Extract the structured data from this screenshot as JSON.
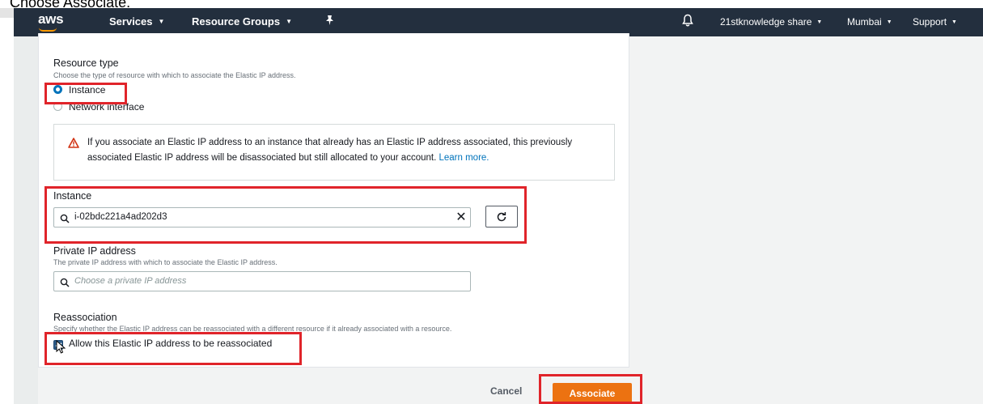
{
  "caption": "Choose Associate.",
  "navbar": {
    "logo": "aws",
    "services": "Services",
    "resource_groups": "Resource Groups",
    "account": "21stknowledge share",
    "region": "Mumbai",
    "support": "Support",
    "background_color": "#232f3e",
    "accent_color": "#ff9900"
  },
  "form": {
    "resource_type": {
      "label": "Resource type",
      "description": "Choose the type of resource with which to associate the Elastic IP address.",
      "options": [
        {
          "label": "Instance",
          "selected": true
        },
        {
          "label": "Network interface",
          "selected": false
        }
      ]
    },
    "alert": {
      "icon": "warning-icon",
      "text": "If you associate an Elastic IP address to an instance that already has an Elastic IP address associated, this previously associated Elastic IP address will be disassociated but still allocated to your account.",
      "link": "Learn more."
    },
    "instance": {
      "label": "Instance",
      "value": "i-02bdc221a4ad202d3"
    },
    "private_ip": {
      "label": "Private IP address",
      "description": "The private IP address with which to associate the Elastic IP address.",
      "placeholder": "Choose a private IP address"
    },
    "reassociation": {
      "label": "Reassociation",
      "description": "Specify whether the Elastic IP address can be reassociated with a different resource if it already associated with a resource.",
      "checkbox_label": "Allow this Elastic IP address to be reassociated",
      "checked": true
    }
  },
  "actions": {
    "cancel": "Cancel",
    "associate": "Associate",
    "primary_color": "#ec7211"
  },
  "highlight_color": "#e0242a"
}
